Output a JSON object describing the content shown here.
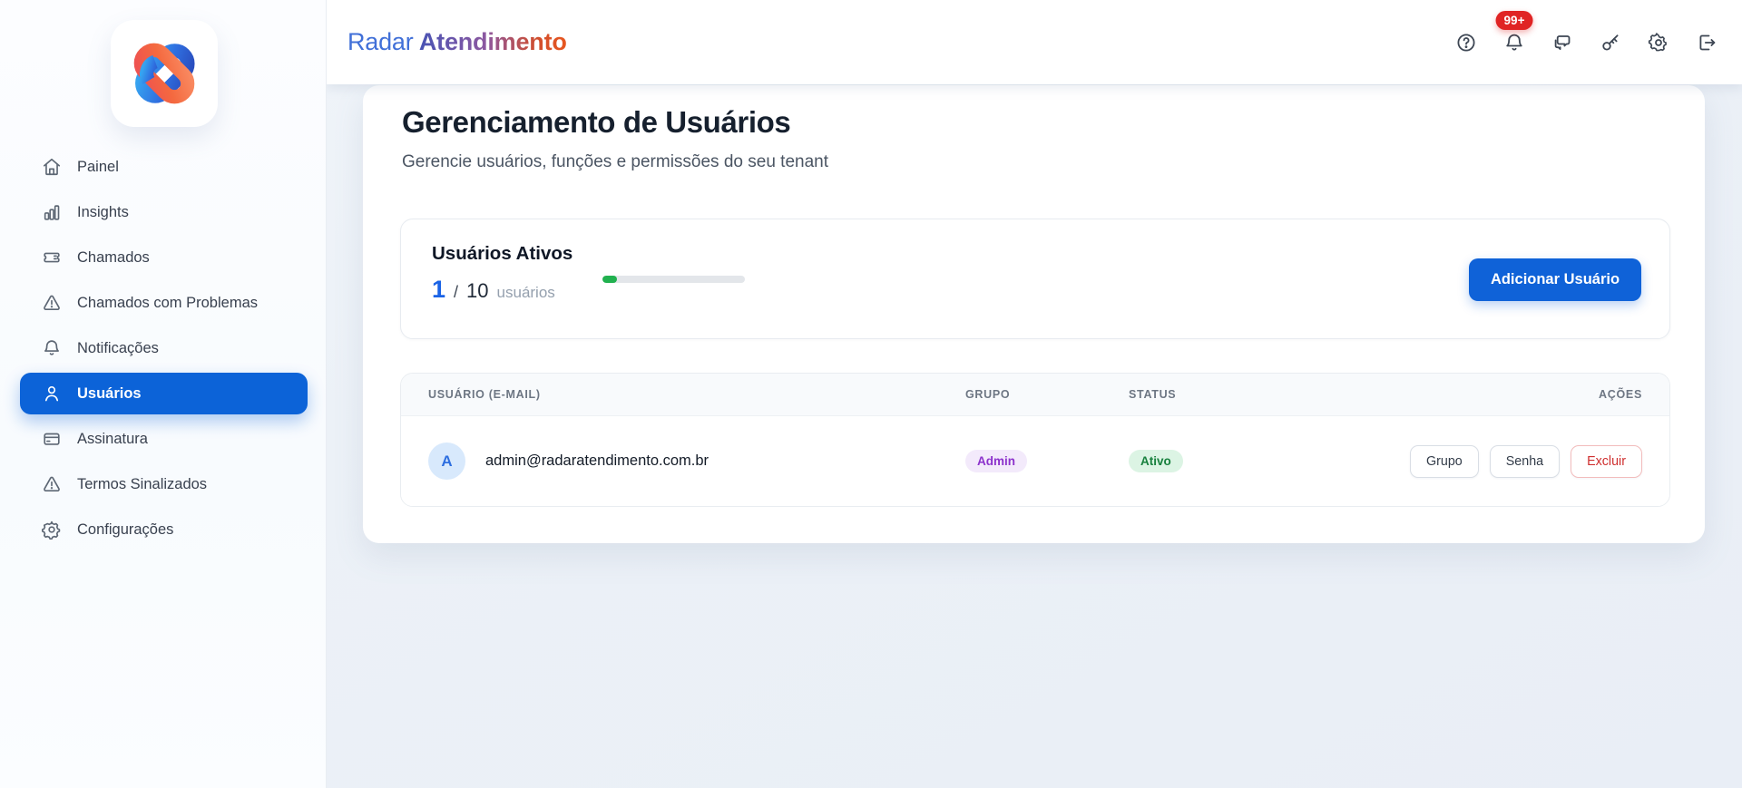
{
  "brand": {
    "name_regular": "Radar",
    "name_bold": "Atendimento"
  },
  "sidebar": {
    "items": [
      {
        "label": "Painel",
        "icon": "home-icon",
        "active": false
      },
      {
        "label": "Insights",
        "icon": "bar-chart-icon",
        "active": false
      },
      {
        "label": "Chamados",
        "icon": "ticket-icon",
        "active": false
      },
      {
        "label": "Chamados com Problemas",
        "icon": "alert-triangle-icon",
        "active": false
      },
      {
        "label": "Notificações",
        "icon": "bell-icon",
        "active": false
      },
      {
        "label": "Usuários",
        "icon": "user-icon",
        "active": true
      },
      {
        "label": "Assinatura",
        "icon": "credit-card-icon",
        "active": false
      },
      {
        "label": "Termos Sinalizados",
        "icon": "alert-triangle-icon",
        "active": false
      },
      {
        "label": "Configurações",
        "icon": "gear-icon",
        "active": false
      }
    ]
  },
  "header": {
    "notification_badge": "99+",
    "icons": [
      "help-icon",
      "bell-icon",
      "messages-icon",
      "key-icon",
      "gear-icon",
      "logout-icon"
    ]
  },
  "page": {
    "title": "Gerenciamento de Usuários",
    "subtitle": "Gerencie usuários, funções e permissões do seu tenant"
  },
  "stats": {
    "title": "Usuários Ativos",
    "current": "1",
    "separator": "/",
    "max": "10",
    "unit": "usuários",
    "progress_pct": 10,
    "add_button_label": "Adicionar Usuário"
  },
  "table": {
    "columns": [
      "USUÁRIO (E-MAIL)",
      "GRUPO",
      "STATUS",
      "AÇÕES"
    ],
    "rows": [
      {
        "avatar_initial": "A",
        "email": "admin@radaratendimento.com.br",
        "group": "Admin",
        "status": "Ativo",
        "actions": [
          "Grupo",
          "Senha",
          "Excluir"
        ]
      }
    ]
  },
  "colors": {
    "accent_blue": "#0c63d8",
    "brand_blue": "#4170d8",
    "brand_gradient_end": "#e8571f",
    "progress_green": "#21b14f",
    "badge_admin_bg": "#f3eafb",
    "badge_admin_text": "#8c32cc",
    "badge_active_bg": "#dcf4e4",
    "badge_active_text": "#18813e",
    "danger_red": "#cf2f2f",
    "notification_red": "#e02424"
  }
}
